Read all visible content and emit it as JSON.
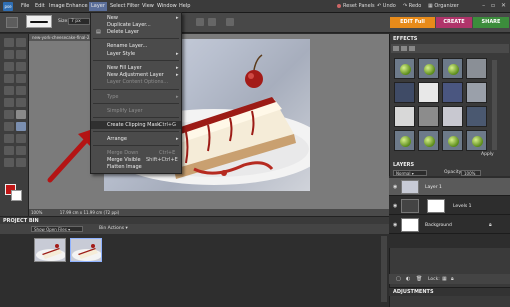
{
  "app": {
    "logo": "pse"
  },
  "menubar": {
    "items": [
      "File",
      "Edit",
      "Image",
      "Enhance",
      "Layer",
      "Select",
      "Filter",
      "View",
      "Window",
      "Help"
    ],
    "actions": {
      "reset_panels": "Reset Panels",
      "undo": "Undo",
      "redo": "Redo",
      "organizer": "Organizer"
    }
  },
  "options_bar": {
    "size_label": "Size:",
    "size_value": "7 px"
  },
  "mode_tabs": {
    "edit": "EDIT Full",
    "create": "CREATE",
    "share": "SHARE"
  },
  "document": {
    "tab_title": "new-york-cheesecake-final-2.jpg @ 14.3% (Layer 1, RGB/8) *",
    "zoom": "100%",
    "dimensions": "17.99 cm x 11.99 cm (72 ppi)"
  },
  "layer_menu": {
    "items": [
      {
        "label": "New",
        "submenu": true,
        "disabled": false
      },
      {
        "label": "Duplicate Layer...",
        "disabled": false
      },
      {
        "label": "Delete Layer",
        "disabled": false
      },
      {
        "label": "Rename Layer...",
        "disabled": false
      },
      {
        "label": "Layer Style",
        "submenu": true,
        "disabled": false
      },
      {
        "label": "New Fill Layer",
        "submenu": true,
        "disabled": false
      },
      {
        "label": "New Adjustment Layer",
        "submenu": true,
        "disabled": false
      },
      {
        "label": "Layer Content Options...",
        "disabled": true
      },
      {
        "label": "Type",
        "submenu": true,
        "disabled": true
      },
      {
        "label": "Simplify Layer",
        "disabled": true
      },
      {
        "label": "Create Clipping Mask",
        "shortcut": "Ctrl+G",
        "disabled": false,
        "highlighted": true
      },
      {
        "label": "Arrange",
        "submenu": true,
        "disabled": false
      },
      {
        "label": "Merge Down",
        "shortcut": "Ctrl+E",
        "disabled": true
      },
      {
        "label": "Merge Visible",
        "shortcut": "Shift+Ctrl+E",
        "disabled": false
      },
      {
        "label": "Flatten Image",
        "disabled": false
      }
    ]
  },
  "project_bin": {
    "title": "PROJECT BIN",
    "show_label": "Show Open Files",
    "bin_actions": "Bin Actions"
  },
  "panels": {
    "effects": {
      "title": "EFFECTS",
      "apply": "Apply"
    },
    "layers": {
      "title": "LAYERS",
      "blend_mode": "Normal",
      "opacity_label": "Opacity:",
      "opacity_value": "100%",
      "layers": [
        {
          "name": "Layer 1",
          "selected": true
        },
        {
          "name": "Levels 1",
          "selected": false
        },
        {
          "name": "Background",
          "selected": false
        }
      ],
      "lock_label": "Lock:"
    },
    "adjustments": {
      "title": "ADJUSTMENTS"
    }
  },
  "colors": {
    "foreground": "#c01616",
    "background": "#ffffff",
    "edit_tab": "#e88b1a",
    "create_tab": "#b0346a",
    "share_tab": "#3c8d3c",
    "arrow": "#b41414"
  }
}
